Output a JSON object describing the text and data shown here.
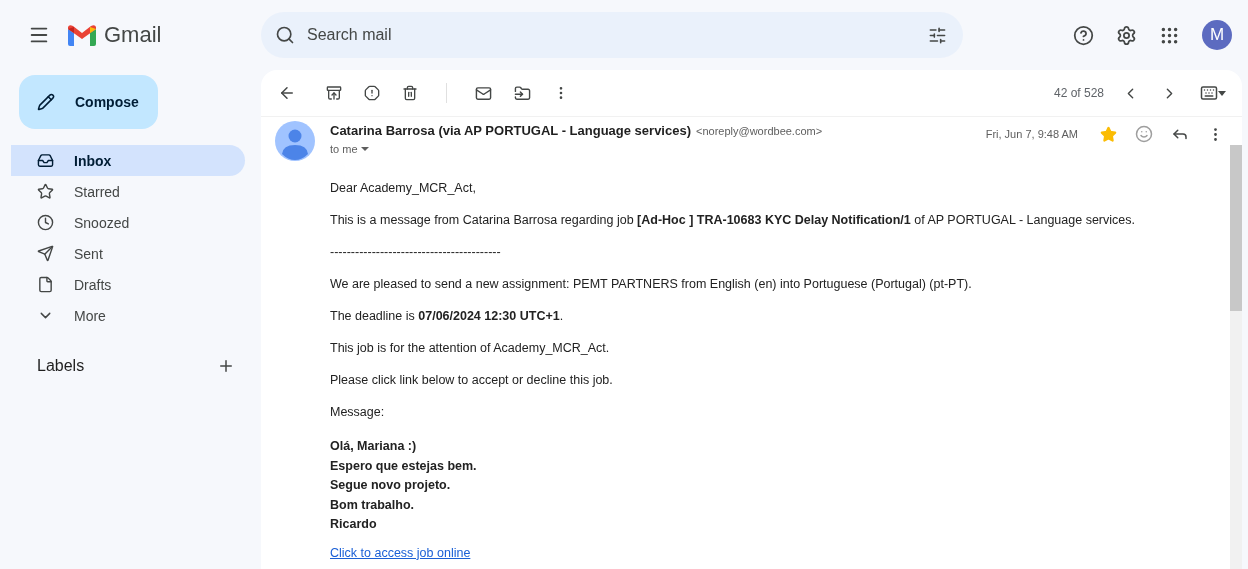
{
  "app": {
    "name": "Gmail"
  },
  "search": {
    "placeholder": "Search mail"
  },
  "account": {
    "initial": "M"
  },
  "compose": {
    "label": "Compose"
  },
  "nav": [
    {
      "label": "Inbox",
      "selected": true
    },
    {
      "label": "Starred",
      "selected": false
    },
    {
      "label": "Snoozed",
      "selected": false
    },
    {
      "label": "Sent",
      "selected": false
    },
    {
      "label": "Drafts",
      "selected": false
    },
    {
      "label": "More",
      "selected": false
    }
  ],
  "labels": {
    "title": "Labels"
  },
  "toolbar": {
    "position": "42 of 528"
  },
  "message": {
    "sender": "Catarina Barrosa (via AP PORTUGAL - Language services)",
    "address": "<noreply@wordbee.com>",
    "recipient": "to me",
    "date": "Fri, Jun 7, 9:48 AM",
    "starred": true,
    "paragraphs": [
      "Dear Academy_MCR_Act,",
      "This is a message from Catarina Barrosa regarding job **[Ad-Hoc ] TRA-10683 KYC Delay Notification/1** of AP PORTUGAL - Language services.",
      "-----------------------------------------",
      "We are pleased to send a new assignment: PEMT PARTNERS from English (en) into Portuguese (Portugal) (pt-PT).",
      "The deadline is **07/06/2024 12:30 UTC+1**.",
      "This job is for the attention of Academy_MCR_Act.",
      "Please click link below to accept or decline this job.",
      "Message:"
    ],
    "signature": [
      "Olá, Mariana :)",
      "Espero que estejas bem.",
      "Segue novo projeto.",
      "Bom trabalho.",
      "Ricardo"
    ],
    "link": "Click to access job online"
  }
}
